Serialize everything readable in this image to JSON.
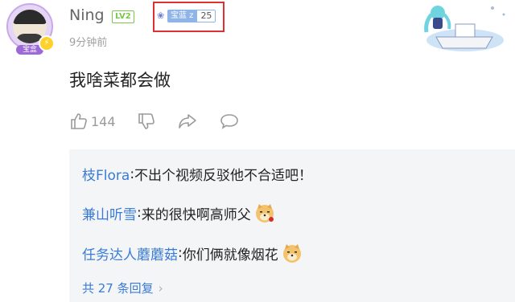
{
  "comment": {
    "username": "Ning",
    "level_badge": "LV2",
    "avatar_badge": "宝盒",
    "fan_medal": {
      "name": "宝蓝 z",
      "level": "25"
    },
    "time": "9分钟前",
    "text": "我啥菜都会做",
    "like_count": "144"
  },
  "actions": [
    "like-icon",
    "dislike-icon",
    "share-icon",
    "comment-icon"
  ],
  "replies": [
    {
      "name": "枝Flora",
      "sep": ":",
      "text": " 不出个视频反驳他不合适吧！",
      "emoji": null
    },
    {
      "name": "兼山听雪",
      "sep": ":",
      "text": " 来的很快啊高师父",
      "emoji": "doge-rose-emoji"
    },
    {
      "name": "任务达人蘑蘑菇",
      "sep": ":",
      "text": " 你们俩就像烟花",
      "emoji": "doge-emoji"
    }
  ],
  "more_replies": "共 27 条回复",
  "colors": {
    "link": "#3a7bd5",
    "level": "#7ac84a",
    "highlight": "#e03030",
    "panel": "#f4f5f7"
  }
}
